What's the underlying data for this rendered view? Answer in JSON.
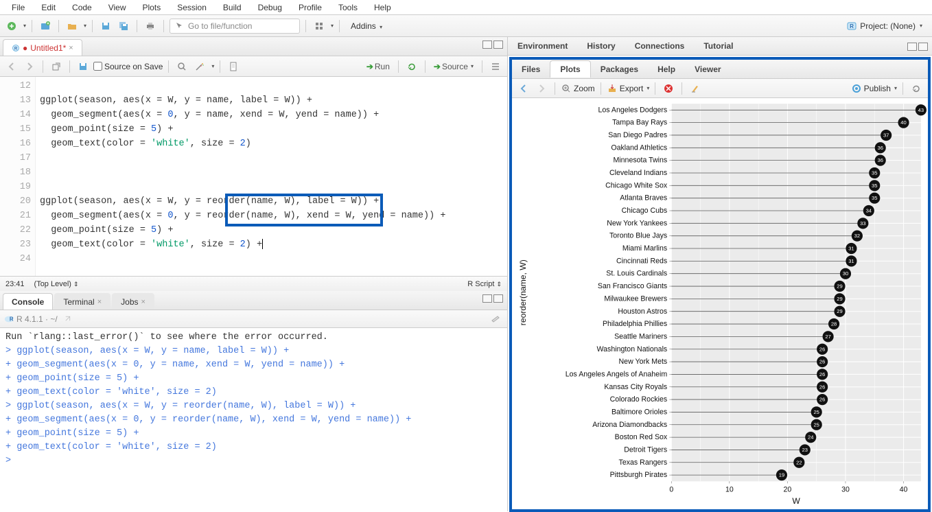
{
  "menu": [
    "File",
    "Edit",
    "Code",
    "View",
    "Plots",
    "Session",
    "Build",
    "Debug",
    "Profile",
    "Tools",
    "Help"
  ],
  "toolbar": {
    "goto": "Go to file/function",
    "addins": "Addins",
    "project": "Project: (None)"
  },
  "source": {
    "tab": "Untitled1*",
    "sourceOnSave": "Source on Save",
    "run": "Run",
    "source_btn": "Source",
    "lines_start": 12,
    "codeLines": [
      "",
      "ggplot(season, aes(x = W, y = name, label = W)) +",
      "  geom_segment(aes(x = 0, y = name, xend = W, yend = name)) +",
      "  geom_point(size = 5) +",
      "  geom_text(color = 'white', size = 2)",
      "",
      "",
      "",
      "ggplot(season, aes(x = W, y = reorder(name, W), label = W)) +",
      "  geom_segment(aes(x = 0, y = reorder(name, W), xend = W, yend = name)) +",
      "  geom_point(size = 5) +",
      "  geom_text(color = 'white', size = 2) +",
      ""
    ],
    "cursor": "23:41",
    "scope": "(Top Level)",
    "lang": "R Script"
  },
  "console": {
    "title": "Console",
    "terminal": "Terminal",
    "jobs": "Jobs",
    "version": "R 4.1.1 · ~/",
    "lines": [
      "Run `rlang::last_error()` to see where the error occurred.",
      "> ggplot(season, aes(x = W, y = name, label = W)) +",
      "+   geom_segment(aes(x = 0, y = name, xend = W, yend = name)) +",
      "+   geom_point(size = 5) +",
      "+   geom_text(color = 'white', size = 2)",
      "> ggplot(season, aes(x = W, y = reorder(name, W), label = W)) +",
      "+   geom_segment(aes(x = 0, y = reorder(name, W), xend = W, yend = name)) +",
      "+   geom_point(size = 5) +",
      "+   geom_text(color = 'white', size = 2)",
      "> "
    ]
  },
  "env_tabs": [
    "Environment",
    "History",
    "Connections",
    "Tutorial"
  ],
  "files_tabs": [
    "Files",
    "Plots",
    "Packages",
    "Help",
    "Viewer"
  ],
  "plot_toolbar": {
    "zoom": "Zoom",
    "export": "Export",
    "publish": "Publish"
  },
  "chart_data": {
    "type": "lollipop",
    "ylabel": "reorder(name, W)",
    "xlabel": "W",
    "xlim": [
      0,
      43
    ],
    "xticks": [
      0,
      10,
      20,
      30,
      40
    ],
    "series": [
      {
        "name": "Los Angeles Dodgers",
        "value": 43
      },
      {
        "name": "Tampa Bay Rays",
        "value": 40
      },
      {
        "name": "San Diego Padres",
        "value": 37
      },
      {
        "name": "Oakland Athletics",
        "value": 36
      },
      {
        "name": "Minnesota Twins",
        "value": 36
      },
      {
        "name": "Cleveland Indians",
        "value": 35
      },
      {
        "name": "Chicago White Sox",
        "value": 35
      },
      {
        "name": "Atlanta Braves",
        "value": 35
      },
      {
        "name": "Chicago Cubs",
        "value": 34
      },
      {
        "name": "New York Yankees",
        "value": 33
      },
      {
        "name": "Toronto Blue Jays",
        "value": 32
      },
      {
        "name": "Miami Marlins",
        "value": 31
      },
      {
        "name": "Cincinnati Reds",
        "value": 31
      },
      {
        "name": "St. Louis Cardinals",
        "value": 30
      },
      {
        "name": "San Francisco Giants",
        "value": 29
      },
      {
        "name": "Milwaukee Brewers",
        "value": 29
      },
      {
        "name": "Houston Astros",
        "value": 29
      },
      {
        "name": "Philadelphia Phillies",
        "value": 28
      },
      {
        "name": "Seattle Mariners",
        "value": 27
      },
      {
        "name": "Washington Nationals",
        "value": 26
      },
      {
        "name": "New York Mets",
        "value": 26
      },
      {
        "name": "Los Angeles Angels of Anaheim",
        "value": 26
      },
      {
        "name": "Kansas City Royals",
        "value": 26
      },
      {
        "name": "Colorado Rockies",
        "value": 26
      },
      {
        "name": "Baltimore Orioles",
        "value": 25
      },
      {
        "name": "Arizona Diamondbacks",
        "value": 25
      },
      {
        "name": "Boston Red Sox",
        "value": 24
      },
      {
        "name": "Detroit Tigers",
        "value": 23
      },
      {
        "name": "Texas Rangers",
        "value": 22
      },
      {
        "name": "Pittsburgh Pirates",
        "value": 19
      }
    ]
  }
}
